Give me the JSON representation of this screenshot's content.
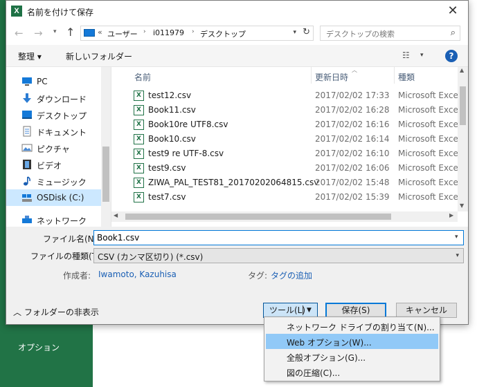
{
  "background": {
    "options_label": "オプション",
    "accent": "#217346"
  },
  "dialog": {
    "title": "名前を付けて保存",
    "app_icon_letter": "X"
  },
  "address": {
    "overflow": "«",
    "crumbs": [
      "ユーザー",
      "i011979",
      "デスクトップ"
    ],
    "search_placeholder": "デスクトップの検索"
  },
  "toolbar": {
    "organize": "整理 ▾",
    "new_folder": "新しいフォルダー",
    "help": "?"
  },
  "nav": [
    {
      "label": "PC",
      "icon": "pc-icon"
    },
    {
      "label": "ダウンロード",
      "icon": "download-icon"
    },
    {
      "label": "デスクトップ",
      "icon": "desktop-icon"
    },
    {
      "label": "ドキュメント",
      "icon": "document-icon"
    },
    {
      "label": "ピクチャ",
      "icon": "picture-icon"
    },
    {
      "label": "ビデオ",
      "icon": "video-icon"
    },
    {
      "label": "ミュージック",
      "icon": "music-icon"
    },
    {
      "label": "OSDisk (C:)",
      "icon": "disk-icon"
    },
    {
      "label": "ネットワーク",
      "icon": "network-icon"
    }
  ],
  "columns": {
    "name": "名前",
    "date": "更新日時",
    "type": "種類"
  },
  "files": [
    {
      "name": "test12.csv",
      "date": "2017/02/02 17:33",
      "type": "Microsoft Excel C"
    },
    {
      "name": "Book11.csv",
      "date": "2017/02/02 16:28",
      "type": "Microsoft Excel C"
    },
    {
      "name": "Book10re UTF8.csv",
      "date": "2017/02/02 16:16",
      "type": "Microsoft Excel C"
    },
    {
      "name": "Book10.csv",
      "date": "2017/02/02 16:14",
      "type": "Microsoft Excel C"
    },
    {
      "name": "test9 re UTF-8.csv",
      "date": "2017/02/02 16:10",
      "type": "Microsoft Excel C"
    },
    {
      "name": "test9.csv",
      "date": "2017/02/02 16:06",
      "type": "Microsoft Excel C"
    },
    {
      "name": "ZIWA_PAL_TEST81_20170202064815.csv",
      "date": "2017/02/02 15:48",
      "type": "Microsoft Excel C"
    },
    {
      "name": "test7.csv",
      "date": "2017/02/02 15:39",
      "type": "Microsoft Excel C"
    }
  ],
  "form": {
    "filename_label": "ファイル名(N):",
    "filename_value": "Book1.csv",
    "filetype_label": "ファイルの種類(T):",
    "filetype_value": "CSV (カンマ区切り) (*.csv)",
    "author_label": "作成者:",
    "author_value": "Iwamoto, Kazuhisa",
    "tags_label": "タグ:",
    "tags_value": "タグの追加"
  },
  "footer": {
    "hide_folders": "フォルダーの非表示",
    "tools": "ツール(L)",
    "save": "保存(S)",
    "cancel": "キャンセル"
  },
  "tools_menu": [
    "ネットワーク ドライブの割り当て(N)...",
    "Web オプション(W)...",
    "全般オプション(G)...",
    "図の圧縮(C)..."
  ]
}
